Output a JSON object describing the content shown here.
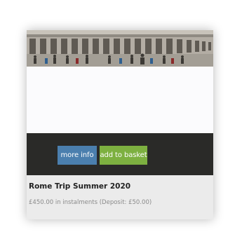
{
  "product": {
    "image_alt": "Rome colonnade photo",
    "more_info_label": "more info",
    "add_to_basket_label": "add to basket",
    "title": "Rome Trip Summer 2020",
    "price_text": "£450.00 in instalments (Deposit: £50.00)"
  },
  "colors": {
    "more_info_bg": "#4b7fae",
    "add_to_basket_bg": "#7db040",
    "action_bar_bg": "#2a2a28",
    "details_bg": "#ebebeb"
  }
}
